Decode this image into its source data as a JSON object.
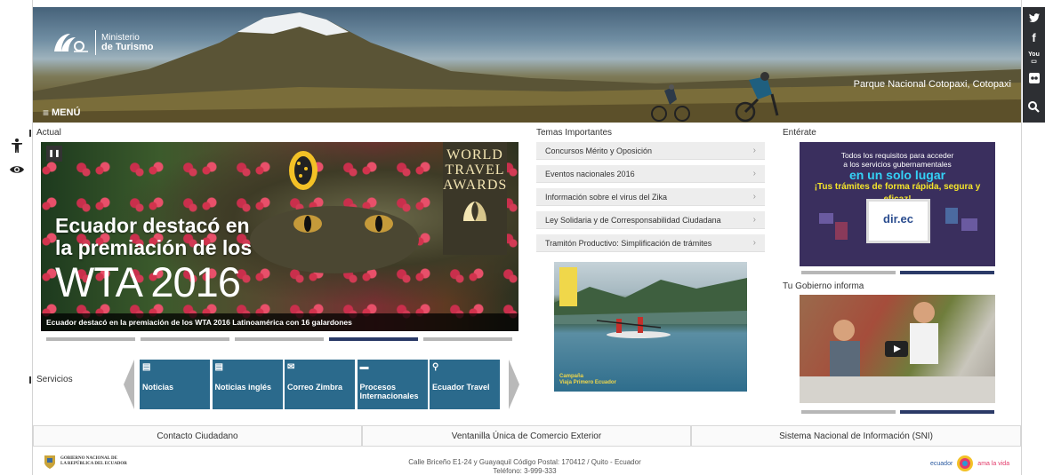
{
  "hero": {
    "logo_line1": "Ministerio",
    "logo_line2": "de Turismo",
    "caption": "Parque Nacional Cotopaxi, Cotopaxi",
    "menu_label": "MENÚ"
  },
  "social": [
    {
      "icon": "twitter-icon",
      "glyph": "t"
    },
    {
      "icon": "facebook-icon",
      "glyph": "f"
    },
    {
      "icon": "youtube-icon",
      "glyph": "You"
    },
    {
      "icon": "flickr-icon",
      "glyph": "••"
    },
    {
      "icon": "search-icon",
      "glyph": "⌕"
    }
  ],
  "sections": {
    "actual": "Actual",
    "temas": "Temas Importantes",
    "enterate": "Entérate",
    "gobierno": "Tu Gobierno informa",
    "servicios": "Servicios"
  },
  "slider": {
    "headline_1": "Ecuador destacó en",
    "headline_2": "la premiación de los",
    "headline_3": "WTA 2016",
    "award_1": "WORLD",
    "award_2": "TRAVEL",
    "award_3": "AWARDS",
    "caption": "Ecuador destacó en la premiación de los WTA 2016 Latinoamérica con 16 galardones",
    "active_slide": 4,
    "slide_count": 5
  },
  "temas": [
    "Concursos Mérito y Oposición",
    "Eventos nacionales 2016",
    "Información sobre el virus del Zika",
    "Ley Solidaria y de Corresponsabilidad Ciudadana",
    "Tramitón Productivo: Simplificación de trámites"
  ],
  "kayak": {
    "badge_text": "Viaja Primero Ecuador",
    "caption_1": "Campaña",
    "caption_2": "Viaja Primero Ecuador"
  },
  "enterate_banner": {
    "line1": "Todos los requisitos para acceder",
    "line2": "a los servicios gubernamentales",
    "line3": "en un solo lugar",
    "line4": "¡Tus trámites de forma rápida, segura y eficaz!",
    "brand": "dir.ec"
  },
  "servicios": [
    {
      "label": "Noticias",
      "icon": "document-icon",
      "glyph": "▤"
    },
    {
      "label": "Noticias inglés",
      "icon": "document-icon",
      "glyph": "▤"
    },
    {
      "label": "Correo Zimbra",
      "icon": "mail-icon",
      "glyph": "✉"
    },
    {
      "label": "Procesos Internacionales",
      "icon": "folder-icon",
      "glyph": "▬"
    },
    {
      "label": "Ecuador Travel",
      "icon": "map-pin-icon",
      "glyph": "⚲"
    }
  ],
  "footer": {
    "links": [
      "Contacto Ciudadano",
      "Ventanilla Única de Comercio Exterior",
      "Sistema Nacional de Información (SNI)"
    ],
    "address_1": "Calle Briceño E1-24 y Guayaquil Código Postal: 170412 / Quito - Ecuador",
    "address_2": "Teléfono: 3-999-333",
    "gov_1": "GOBIERNO NACIONAL DE",
    "gov_2": "LA REPÚBLICA DEL ECUADOR",
    "brand_left": "ecuador",
    "brand_right": "ama la vida"
  },
  "colors": {
    "service_tile": "#2b6a8c",
    "pager_active": "#2b3a67",
    "pager_inactive": "#b7b7b7",
    "social_bar": "#2d2f33"
  }
}
